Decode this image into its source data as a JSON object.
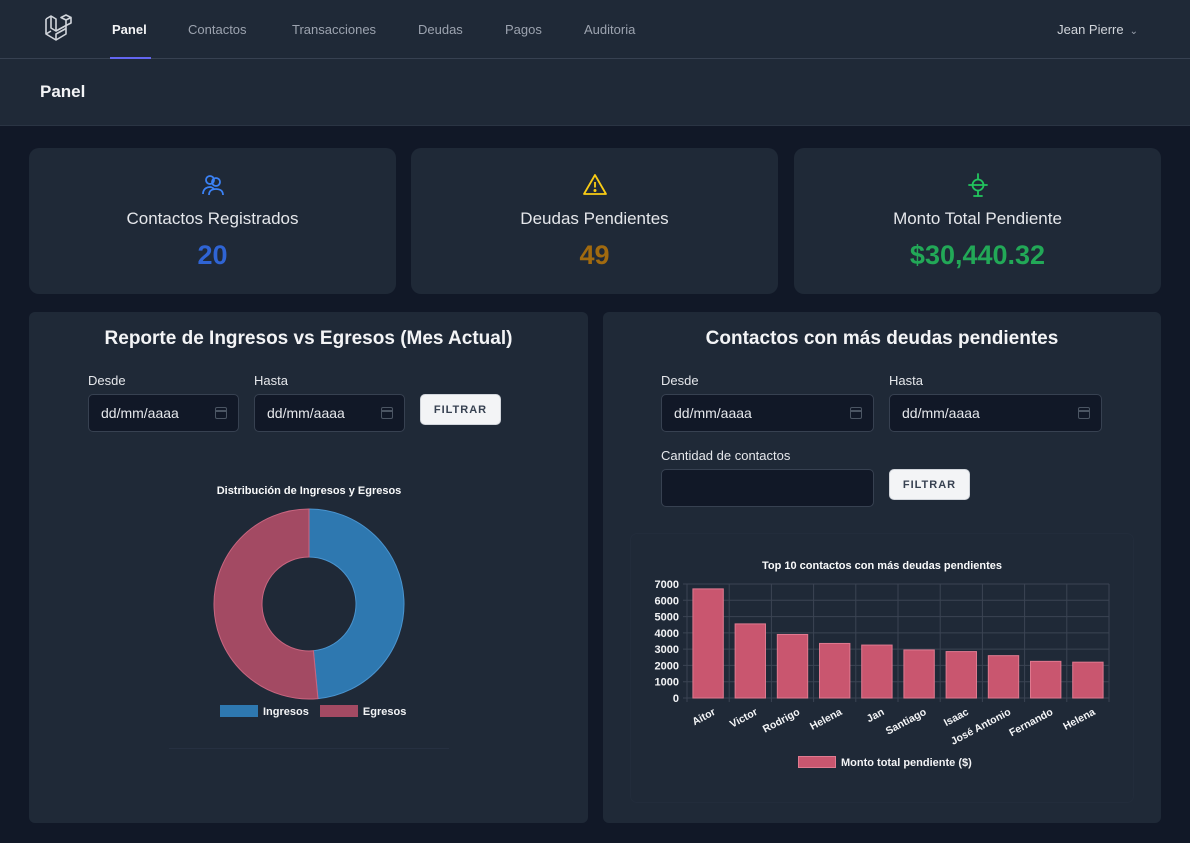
{
  "nav": {
    "items": [
      "Panel",
      "Contactos",
      "Transacciones",
      "Deudas",
      "Pagos",
      "Auditoria"
    ],
    "active": "Panel",
    "user": "Jean Pierre"
  },
  "header": {
    "title": "Panel"
  },
  "stats": [
    {
      "label": "Contactos Registrados",
      "value": "20",
      "color": "#2f64d4",
      "icon": "users-icon"
    },
    {
      "label": "Deudas Pendientes",
      "value": "49",
      "color": "#a16a0f",
      "icon": "warning-icon"
    },
    {
      "label": "Monto Total Pendiente",
      "value": "$30,440.32",
      "color": "#22a857",
      "icon": "scale-icon"
    }
  ],
  "income_panel": {
    "title": "Reporte de Ingresos vs Egresos (Mes Actual)",
    "from_label": "Desde",
    "to_label": "Hasta",
    "from_placeholder": "dd/mm/aaaa",
    "to_placeholder": "dd/mm/aaaa",
    "filter_label": "FILTRAR"
  },
  "debts_panel": {
    "title": "Contactos con más deudas pendientes",
    "from_label": "Desde",
    "to_label": "Hasta",
    "from_placeholder": "dd/mm/aaaa",
    "to_placeholder": "dd/mm/aaaa",
    "count_label": "Cantidad de contactos",
    "count_value": "",
    "filter_label": "FILTRAR"
  },
  "chart_data": [
    {
      "type": "pie",
      "title": "Distribución de Ingresos y Egresos",
      "categories": [
        "Ingresos",
        "Egresos"
      ],
      "values": [
        48.5,
        51.5
      ],
      "colors": [
        "#2e78b0",
        "#a34a63"
      ],
      "legend": "bottom"
    },
    {
      "type": "bar",
      "title": "Top 10 contactos con más deudas pendientes",
      "categories": [
        "Aitor",
        "Victor",
        "Rodrigo",
        "Helena",
        "Jan",
        "Santiago",
        "Isaac",
        "José Antonio",
        "Fernando",
        "Helena"
      ],
      "series": [
        {
          "name": "Monto total pendiente ($)",
          "values": [
            6700,
            4550,
            3900,
            3350,
            3250,
            2950,
            2850,
            2600,
            2250,
            2200
          ]
        }
      ],
      "ylim": [
        0,
        7000
      ],
      "yticks": [
        0,
        1000,
        2000,
        3000,
        4000,
        5000,
        6000,
        7000
      ],
      "color": "#c9566f",
      "grid": true,
      "legend": "bottom"
    }
  ]
}
